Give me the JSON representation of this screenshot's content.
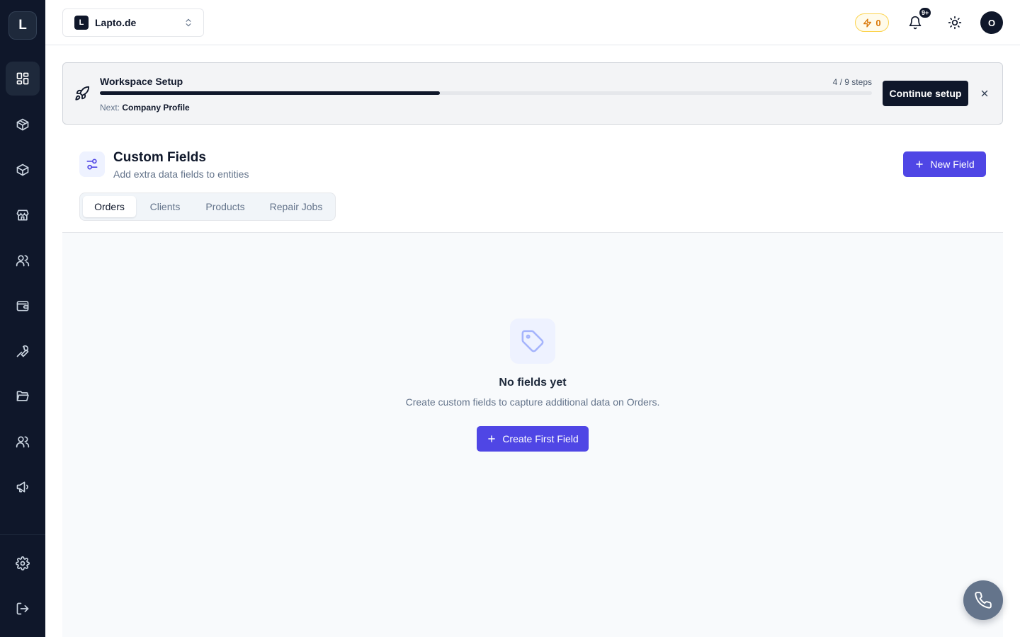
{
  "sidebar": {
    "logo": "L",
    "items": [
      {
        "name": "sidebar-item-dashboard",
        "icon": "grid-icon",
        "active": true
      },
      {
        "name": "sidebar-item-products",
        "icon": "box-icon"
      },
      {
        "name": "sidebar-item-inventory",
        "icon": "package-icon"
      },
      {
        "name": "sidebar-item-store",
        "icon": "store-icon"
      },
      {
        "name": "sidebar-item-clients",
        "icon": "users-icon"
      },
      {
        "name": "sidebar-item-wallet",
        "icon": "wallet-icon"
      },
      {
        "name": "sidebar-item-repairs",
        "icon": "wrench-icon"
      },
      {
        "name": "sidebar-item-files",
        "icon": "folder-icon"
      },
      {
        "name": "sidebar-item-team",
        "icon": "users-icon"
      },
      {
        "name": "sidebar-item-marketing",
        "icon": "megaphone-icon"
      },
      {
        "name": "sidebar-item-settings",
        "icon": "gear-icon"
      },
      {
        "name": "sidebar-item-logout",
        "icon": "logout-icon"
      }
    ]
  },
  "topbar": {
    "workspace_badge": "L",
    "workspace_name": "Lapto.de",
    "credits": "0",
    "notifications_badge": "9+",
    "avatar": "O"
  },
  "banner": {
    "title": "Workspace Setup",
    "steps": "4 / 9 steps",
    "progress": 0.44,
    "next_label": "Next:",
    "next_value": "Company Profile",
    "continue_label": "Continue setup"
  },
  "page": {
    "title": "Custom Fields",
    "subtitle": "Add extra data fields to entities",
    "new_button": "New Field"
  },
  "tabs": [
    {
      "label": "Orders",
      "active": true
    },
    {
      "label": "Clients"
    },
    {
      "label": "Products"
    },
    {
      "label": "Repair Jobs"
    }
  ],
  "empty": {
    "title": "No fields yet",
    "text": "Create custom fields to capture additional data on Orders.",
    "button": "Create First Field"
  },
  "colors": {
    "sidebar_bg": "#0f172a",
    "primary": "#4f46e5",
    "credits": "#d97706"
  }
}
